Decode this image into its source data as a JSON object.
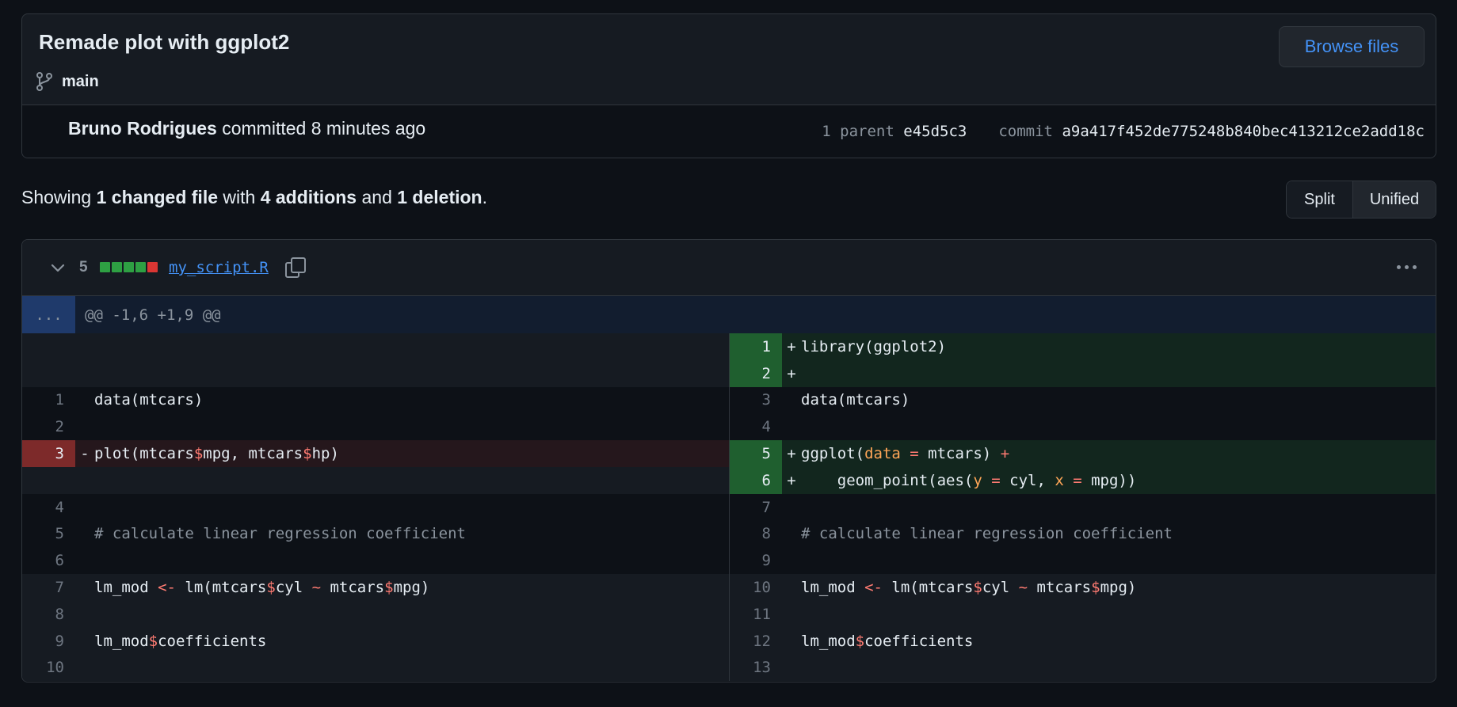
{
  "commit": {
    "title": "Remade plot with ggplot2",
    "branch": "main",
    "browse_files": "Browse files",
    "author": "Bruno Rodrigues",
    "action": " committed 8 minutes ago",
    "parent_label": "1 parent",
    "parent_sha": "e45d5c3",
    "commit_label": "commit",
    "commit_sha": "a9a417f452de775248b840bec413212ce2add18c"
  },
  "summary": {
    "prefix": "Showing ",
    "files": "1 changed file",
    "with": " with ",
    "additions": "4 additions",
    "and": " and ",
    "deletions": "1 deletion",
    "end": "."
  },
  "view_toggle": {
    "split": "Split",
    "unified": "Unified"
  },
  "file": {
    "changes": "5",
    "name": "my_script.R",
    "blocks": [
      "#2ea043",
      "#2ea043",
      "#2ea043",
      "#2ea043",
      "#da3633"
    ]
  },
  "hunk": {
    "expand": "...",
    "header": "@@ -1,6 +1,9 @@"
  },
  "left": {
    "n1": "1",
    "c1": "data(mtcars)",
    "n2": "2",
    "n3": "3",
    "s3": "-",
    "c3a": "plot(mtcars",
    "c3b": "$",
    "c3c": "mpg, mtcars",
    "c3d": "$",
    "c3e": "hp)",
    "n4": "4",
    "n5": "5",
    "c5": "# calculate linear regression coefficient",
    "n6": "6",
    "n7": "7",
    "c7a": "lm_mod ",
    "c7b": "<-",
    "c7c": " lm(mtcars",
    "c7d": "$",
    "c7e": "cyl ",
    "c7f": "~",
    "c7g": " mtcars",
    "c7h": "$",
    "c7i": "mpg)",
    "n8": "8",
    "n9": "9",
    "c9a": "lm_mod",
    "c9b": "$",
    "c9c": "coefficients",
    "n10": "10"
  },
  "right": {
    "n1": "1",
    "s1": "+",
    "c1": "library(ggplot2)",
    "n2": "2",
    "s2": "+",
    "n3": "3",
    "c3": "data(mtcars)",
    "n4": "4",
    "n5": "5",
    "s5": "+",
    "c5a": "ggplot(",
    "c5b": "data",
    "c5c": " = ",
    "c5d": "mtcars) ",
    "c5e": "+",
    "n6": "6",
    "s6": "+",
    "c6a": "    geom_point(aes(",
    "c6b": "y",
    "c6c": " = ",
    "c6d": "cyl, ",
    "c6e": "x",
    "c6f": " = ",
    "c6g": "mpg))",
    "n7": "7",
    "n8": "8",
    "c8": "# calculate linear regression coefficient",
    "n9": "9",
    "n10": "10",
    "c10a": "lm_mod ",
    "c10b": "<-",
    "c10c": " lm(mtcars",
    "c10d": "$",
    "c10e": "cyl ",
    "c10f": "~",
    "c10g": " mtcars",
    "c10h": "$",
    "c10i": "mpg)",
    "n11": "11",
    "n12": "12",
    "c12a": "lm_mod",
    "c12b": "$",
    "c12c": "coefficients",
    "n13": "13"
  },
  "colors": {
    "background": "#0d1117",
    "accent": "#4493f8",
    "addition": "#2ea043",
    "deletion": "#da3633"
  }
}
